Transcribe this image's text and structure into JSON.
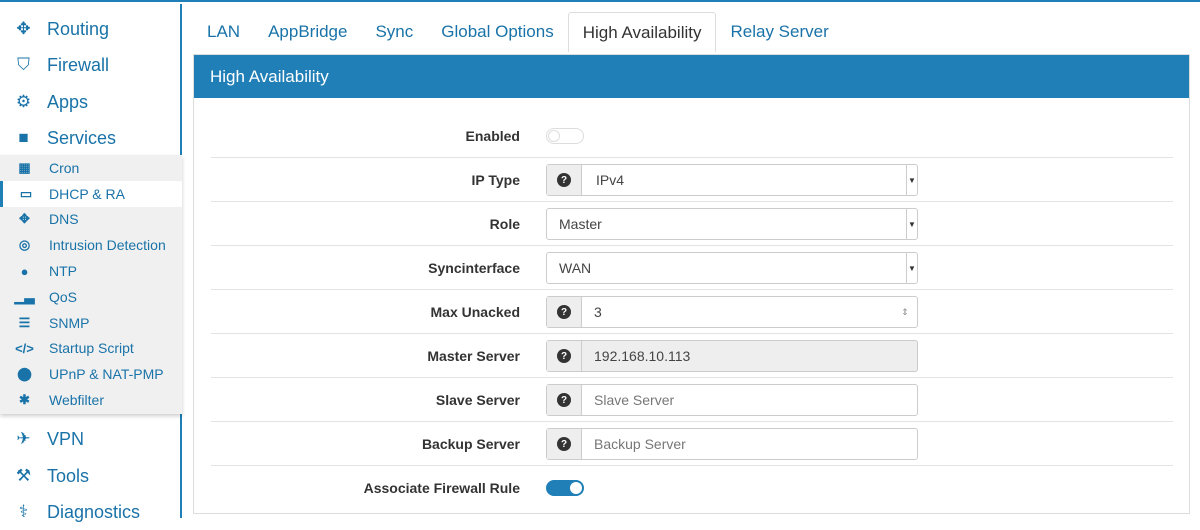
{
  "sidebar": {
    "top": [
      {
        "label": "Routing",
        "icon": "arrows-icon"
      },
      {
        "label": "Firewall",
        "icon": "shield-icon"
      },
      {
        "label": "Apps",
        "icon": "gears-icon"
      },
      {
        "label": "Services",
        "icon": "briefcase-icon"
      }
    ],
    "sub": [
      {
        "label": "Cron",
        "icon": "calendar-icon"
      },
      {
        "label": "DHCP & RA",
        "icon": "laptop-icon"
      },
      {
        "label": "DNS",
        "icon": "arrows-icon"
      },
      {
        "label": "Intrusion Detection",
        "icon": "target-icon"
      },
      {
        "label": "NTP",
        "icon": "clock-icon"
      },
      {
        "label": "QoS",
        "icon": "bar-chart-icon"
      },
      {
        "label": "SNMP",
        "icon": "server-icon"
      },
      {
        "label": "Startup Script",
        "icon": "code-icon"
      },
      {
        "label": "UPnP & NAT-PMP",
        "icon": "map-marker-icon"
      },
      {
        "label": "Webfilter",
        "icon": "asterisk-icon"
      }
    ],
    "bottom": [
      {
        "label": "VPN",
        "icon": "plane-icon"
      },
      {
        "label": "Tools",
        "icon": "hammer-icon"
      },
      {
        "label": "Diagnostics",
        "icon": "stethoscope-icon"
      }
    ]
  },
  "tabs": [
    "LAN",
    "AppBridge",
    "Sync",
    "Global Options",
    "High Availability",
    "Relay Server"
  ],
  "panel": {
    "title": "High Availability"
  },
  "form": {
    "enabled": "Enabled",
    "ip_type": "IP Type",
    "ip_type_value": "IPv4",
    "role": "Role",
    "role_value": "Master",
    "sync": "Syncinterface",
    "sync_value": "WAN",
    "max_unacked": "Max Unacked",
    "max_unacked_value": "3",
    "master": "Master Server",
    "master_value": "192.168.10.113",
    "slave": "Slave Server",
    "slave_ph": "Slave Server",
    "backup": "Backup Server",
    "backup_ph": "Backup Server",
    "assoc": "Associate Firewall Rule"
  },
  "colors": {
    "accent": "#1f7fb6"
  }
}
